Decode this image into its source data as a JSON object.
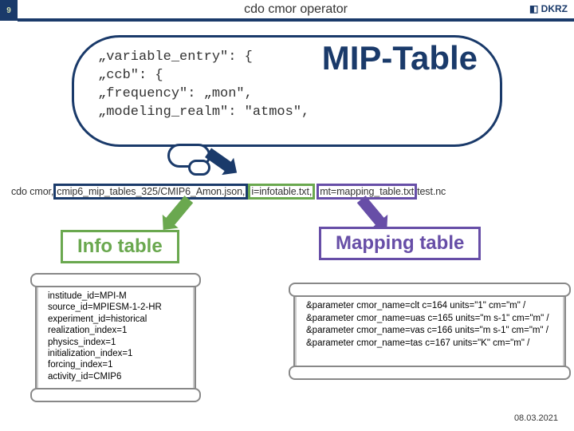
{
  "page_number": "9",
  "title": "cdo cmor operator",
  "logo_text": "DKRZ",
  "mip_label": "MIP-Table",
  "code_lines": {
    "l1": "„variable_entry\": {",
    "l2": "    „ccb\": {",
    "l3": "        „frequency\": „mon\",",
    "l4": "        „modeling_realm\": \"atmos\","
  },
  "cmd": {
    "prefix": "cdo cmor,",
    "cmip": "cmip6_mip_tables_325/CMIP6_Amon.json,",
    "info": "i=infotable.txt,",
    "map": "mt=mapping_table.txt",
    "suffix": " test.nc"
  },
  "labels": {
    "info": "Info table",
    "mapping": "Mapping table"
  },
  "info_table": {
    "l1": "institude_id=MPI-M",
    "l2": "source_id=MPIESM-1-2-HR",
    "l3": "experiment_id=historical",
    "l4": "realization_index=1",
    "l5": "physics_index=1",
    "l6": "initialization_index=1",
    "l7": "forcing_index=1",
    "l8": "activity_id=CMIP6"
  },
  "mapping_table": {
    "l1": "&parameter cmor_name=clt c=164 units=\"1\"      cm=\"m\" /",
    "l2": "&parameter cmor_name=uas c=165 units=\"m s-1\" cm=\"m\" /",
    "l3": "&parameter cmor_name=vas c=166 units=\"m s-1\" cm=\"m\" /",
    "l4": "&parameter cmor_name=tas c=167 units=\"K\"     cm=\"m\" /"
  },
  "footer_date": "08.03.2021"
}
